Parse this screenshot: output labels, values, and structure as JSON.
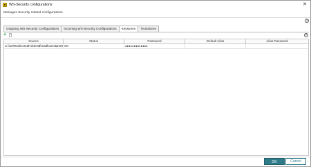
{
  "window": {
    "title": "WS-Security configurations",
    "icon": "app-icon",
    "close": "✕"
  },
  "header": {
    "subtitle": "Manages Security related configurations",
    "help": "?"
  },
  "tabs": [
    {
      "label": "Outgoing WS-Security Configurations"
    },
    {
      "label": "Incoming WS-Security Configurations"
    },
    {
      "label": "Keystores",
      "active": true
    },
    {
      "label": "Truststores"
    }
  ],
  "toolbar": {
    "add": "+",
    "help": "?"
  },
  "table": {
    "columns": [
      "Source",
      "Status",
      "Password",
      "Default Alias",
      "Alias Password"
    ],
    "rows": [
      {
        "source": "C:\\\\10\\RedirectedFolders$\\madhusmitam064\\...",
        "status": "OK",
        "password": "●●●●●●●●●●●●●",
        "default_alias": "",
        "alias_password": ""
      }
    ]
  },
  "footer": {
    "ok_label": "OK",
    "cancel_label": "Cancel",
    "accent": "#2e7b8a"
  }
}
